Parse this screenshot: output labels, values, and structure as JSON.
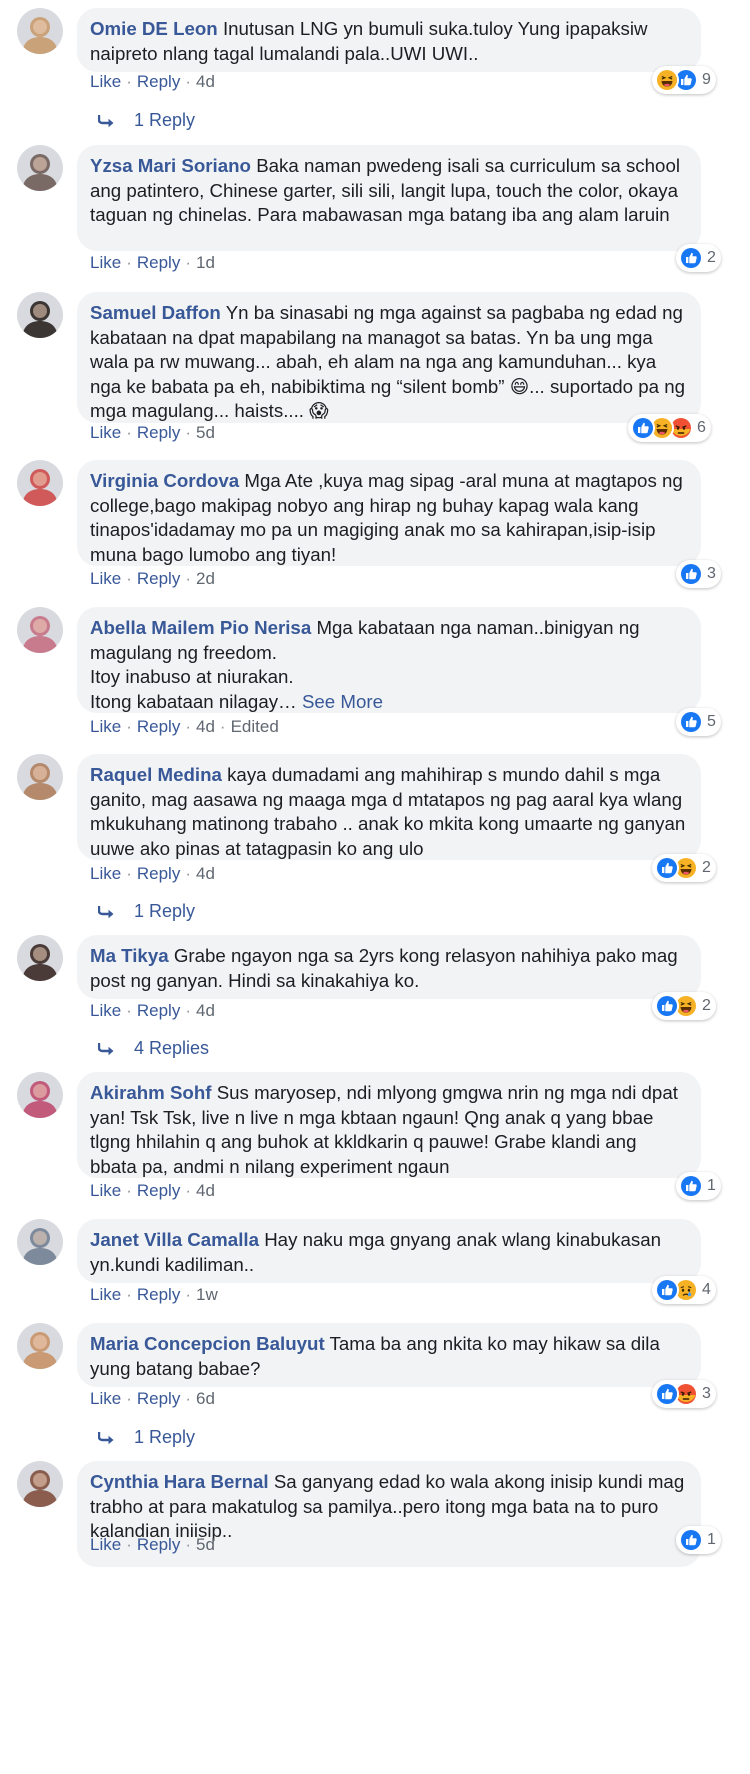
{
  "actions": {
    "like": "Like",
    "reply": "Reply"
  },
  "comments": [
    {
      "name": "Omie DE Leon",
      "text": "Inutusan LNG yn bumuli suka.tuloy Yung ipapaksiw naipreto nlang tagal lumalandi pala..UWI UWI..",
      "time": "4d",
      "reactions": [
        "haha",
        "like"
      ],
      "reaction_count": "9",
      "replies": "1 Reply",
      "avatar_color": "#c9a27a"
    },
    {
      "name": "Yzsa Mari Soriano",
      "text": "Baka naman pwedeng isali sa curriculum sa school ang patintero, Chinese garter, sili sili, langit lupa, touch the color, okaya taguan ng chinelas. Para mabawasan mga batang iba ang alam laruin",
      "time": "1d",
      "reactions": [
        "like"
      ],
      "reaction_count": "2",
      "avatar_color": "#7a6a66"
    },
    {
      "name": "Samuel Daffon",
      "text": "Yn ba sinasabi ng mga against sa pagbaba ng edad ng kabataan na dpat mapabilang na managot sa batas. Yn ba ung mga wala pa rw muwang... abah, eh alam na nga ang kamunduhan... kya nga ke babata pa eh, nabibiktima ng “silent bomb” 😄... suportado pa ng mga magulang... haists.... 😱",
      "time": "5d",
      "reactions": [
        "like",
        "haha",
        "angry"
      ],
      "reaction_count": "6",
      "avatar_color": "#3b3533"
    },
    {
      "name": "Virginia Cordova",
      "text": "Mga Ate ,kuya mag sipag -aral muna at magtapos ng college,bago makipag nobyo ang hirap ng buhay kapag wala kang tinapos'idadamay mo pa un magiging anak mo sa kahirapan,isip-isip muna bago lumobo ang tiyan!",
      "time": "2d",
      "reactions": [
        "like"
      ],
      "reaction_count": "3",
      "avatar_color": "#d0595a"
    },
    {
      "name": "Abella Mailem Pio Nerisa",
      "text_lines": [
        "Mga kabataan nga naman..binigyan ng magulang ng freedom.",
        "Itoy inabuso at niurakan.",
        "Itong kabataan nilagay…"
      ],
      "see_more": "See More",
      "time": "4d",
      "edited": "Edited",
      "reactions": [
        "like"
      ],
      "reaction_count": "5",
      "avatar_color": "#c77b8d"
    },
    {
      "name": "Raquel Medina",
      "text": "kaya dumadami ang mahihirap s mundo dahil s mga ganito, mag aasawa ng maaga mga d mtatapos ng pag aaral kya wlang mkukuhang matinong trabaho .. anak ko mkita kong umaarte ng ganyan uuwe ako pinas at tatagpasin ko ang ulo",
      "time": "4d",
      "reactions": [
        "like",
        "haha"
      ],
      "reaction_count": "2",
      "replies": "1 Reply",
      "avatar_color": "#b58a6c"
    },
    {
      "name": "Ma Tikya",
      "text": "Grabe ngayon nga sa 2yrs kong relasyon nahihiya pako mag post ng ganyan. Hindi sa kinakahiya ko.",
      "time": "4d",
      "reactions": [
        "like",
        "haha"
      ],
      "reaction_count": "2",
      "replies": "4 Replies",
      "avatar_color": "#4a3a38"
    },
    {
      "name": "Akirahm Sohf",
      "text": "Sus maryosep, ndi mlyong gmgwa nrin ng mga ndi dpat yan! Tsk Tsk, live n live n mga kbtaan ngaun! Qng anak q yang bbae tlgng hhilahin q ang buhok at kkldkarin q pauwe! Grabe klandi ang bbata pa, andmi n nilang experiment ngaun",
      "time": "4d",
      "reactions": [
        "like"
      ],
      "reaction_count": "1",
      "avatar_color": "#c25a7c"
    },
    {
      "name": "Janet Villa Camalla",
      "text": "Hay naku mga gnyang anak wlang kinabukasan yn.kundi kadiliman..",
      "time": "1w",
      "reactions": [
        "like",
        "sad"
      ],
      "reaction_count": "4",
      "avatar_color": "#7d8a9b"
    },
    {
      "name": "Maria Concepcion Baluyut",
      "text": "Tama ba ang nkita ko may hikaw sa dila yung batang babae?",
      "time": "6d",
      "reactions": [
        "like",
        "angry"
      ],
      "reaction_count": "3",
      "replies": "1 Reply",
      "avatar_color": "#c99a73"
    },
    {
      "name": "Cynthia Hara Bernal",
      "text": "Sa ganyang edad ko wala akong inisip kundi mag trabho at para makatulog sa pamilya..pero itong mga bata na to puro kalandian iniisip..",
      "time": "5d",
      "reactions": [
        "like"
      ],
      "reaction_count": "1",
      "avatar_color": "#8a5d4e"
    }
  ],
  "colors": {
    "name": "#385898",
    "bubble": "#f2f3f5",
    "meta": "#606770",
    "like": "#1877f2",
    "haha": "#f7b125",
    "angry": "#e9710f",
    "sad": "#f7b125"
  }
}
